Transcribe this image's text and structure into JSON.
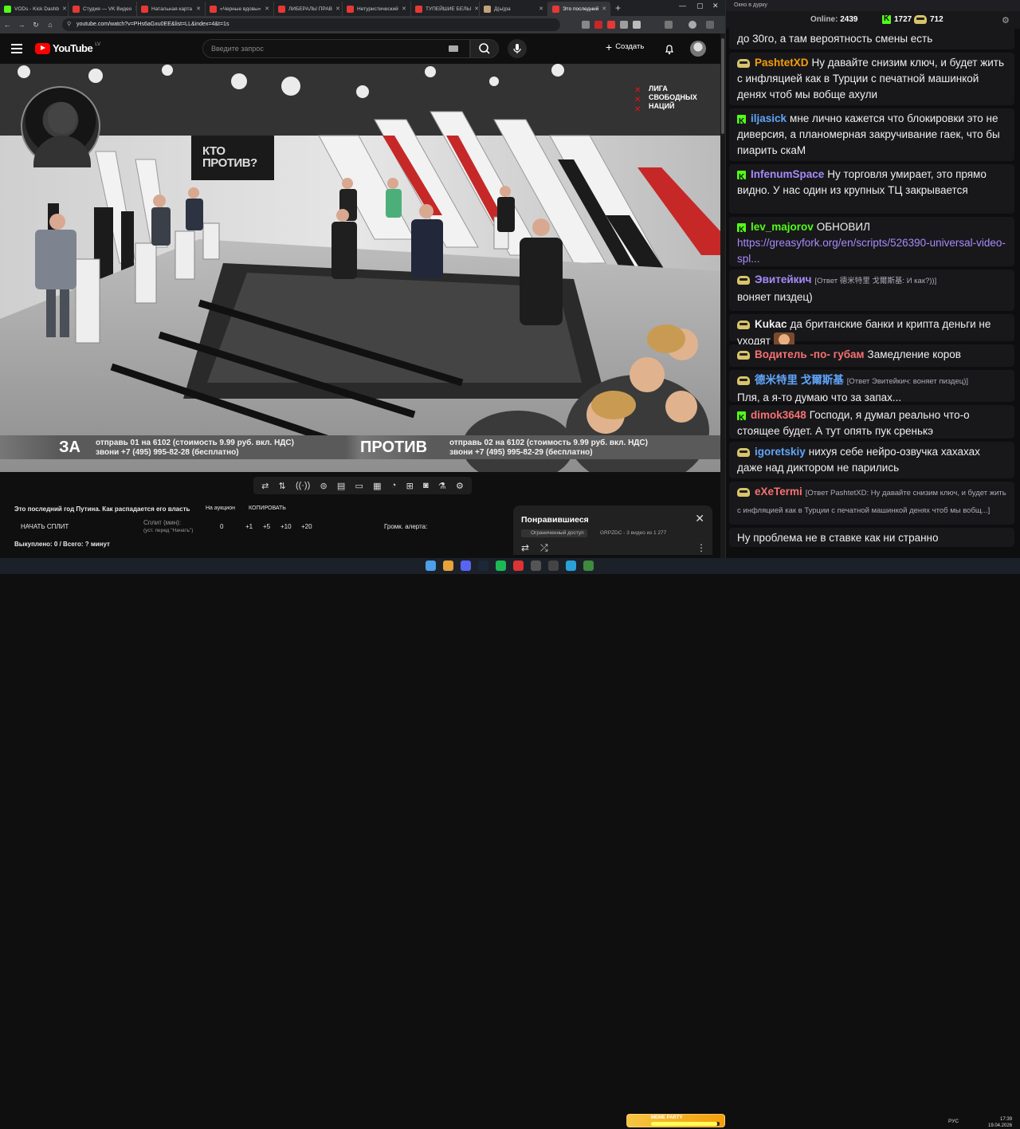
{
  "browser": {
    "tabs": [
      {
        "label": "VODs - Kick Dashb",
        "color": "#53fc18"
      },
      {
        "label": "Студия — VK Видео",
        "color": "#e53935"
      },
      {
        "label": "Натальная карта",
        "color": "#e53935"
      },
      {
        "label": "«Черные вдовы»",
        "color": "#e53935"
      },
      {
        "label": "ЛИБЕРАЛЫ ПРАВ",
        "color": "#e53935"
      },
      {
        "label": "Нетуристический",
        "color": "#e53935"
      },
      {
        "label": "ТУПЕЙШИЕ БЕЛЫ",
        "color": "#e53935"
      },
      {
        "label": "Д(ы)ра",
        "color": "#bfa37a"
      },
      {
        "label": "Это последний",
        "color": "#e53935"
      }
    ],
    "url": "youtube.com/watch?v=PHs6aGxu0EE&list=LL&index=4&t=1s"
  },
  "youtube": {
    "logo_text": "YouTube",
    "country": "LV",
    "search_placeholder": "Введите запрос",
    "create_label": "Создать"
  },
  "video": {
    "liga_text": "ЛИГА СВОБОДНЫХ НАЦИЙ",
    "kto_text": "КТО ПРОТИВ?",
    "za_label": "ЗА",
    "za_line1": "отправь 01 на 6102 (стоимость 9.99 руб. вкл. НДС)",
    "za_line2": "звони +7 (495) 995-82-28 (бесплатно)",
    "protiv_label": "ПРОТИВ",
    "protiv_line1": "отправь 02 на 6102 (стоимость 9.99 руб. вкл. НДС)",
    "protiv_line2": "звони +7 (495) 995-82-29 (бесплатно)"
  },
  "toolbar": {
    "icons": [
      "repeat-icon",
      "sort-icon",
      "audio-icon",
      "video-settings-icon",
      "film-icon",
      "picture-in-picture-icon",
      "subtitles-icon",
      "speed-icon",
      "add-box-icon",
      "camera-icon",
      "flask-icon",
      "gear-icon"
    ],
    "glyphs": [
      "⇄",
      "⇅",
      "((·))",
      "⊜",
      "▤",
      "▭",
      "▦",
      "◔",
      "⊞",
      "◙",
      "⚗",
      "⚙"
    ]
  },
  "split": {
    "title": "Это последний год Путина. Как распадается его власть",
    "auction": "На аукцион",
    "copy": "КОПИРОВАТЬ",
    "start": "НАЧАТЬ СПЛИТ",
    "split_min": "Сплит (мин):",
    "split_hint": "(уст. перед \"Начать\")",
    "value": "0",
    "add1": "+1",
    "add5": "+5",
    "add10": "+10",
    "add20": "+20",
    "alert_volume": "Громк. алерта:",
    "paid_line": "Выкуплено: 0 / Всего: ? минут"
  },
  "liked": {
    "title": "Понравившиеся",
    "access": "Ограниченный доступ",
    "meta": "GRPZDC - 3 видео из 1 277"
  },
  "chat": {
    "window_title": "Окно в дурку",
    "online_label": "Online:",
    "online_count": "2439",
    "kick_count": "1727",
    "emote_count": "712",
    "messages": [
      {
        "user": "",
        "reply": "",
        "text": "до 30го, а там вероятность смены есть",
        "color": "#efeff1",
        "icon": "none"
      },
      {
        "user": "PashtetXD",
        "reply": "",
        "text": "Ну давайте снизим ключ, и будет жить с инфляцией как в Турции с печатной машинкой денях чтоб мы вобще ахули",
        "color": "#f59e0b",
        "icon": "emote"
      },
      {
        "user": "iljasick",
        "reply": "",
        "text": "мне лично кажется что блокировки это не диверсия, а планомерная закручивание гаек, что бы пиарить скаМ",
        "color": "#60a5fa",
        "icon": "kick"
      },
      {
        "user": "InfenumSpace",
        "reply": "",
        "text": "Ну торговля умирает, это прямо видно. У нас один из крупных ТЦ закрывается",
        "color": "#a78bfa",
        "icon": "kick"
      },
      {
        "user": "lev_majorov",
        "reply": "",
        "text": "ОБНОВИЛ",
        "link": "https://greasyfork.org/en/scripts/526390-universal-video-spl...",
        "color": "#53fc18",
        "icon": "kick"
      },
      {
        "user": "Эвитейкич",
        "reply": "[Ответ 德米特里 戈爾斯基: И как?))]",
        "text": "воняет пиздец)",
        "color": "#a78bfa",
        "icon": "emote"
      },
      {
        "user": "Kukac",
        "reply": "",
        "text": "да британские банки и крипта деньги не уходят",
        "color": "#efeff1",
        "icon": "emote"
      },
      {
        "user": "Водитель -по- губам",
        "reply": "",
        "text": "Замедление коров",
        "color": "#f87171",
        "icon": "emote"
      },
      {
        "user": "德米特里 戈爾斯基",
        "reply": "[Ответ Эвитейкич: воняет пиздец)]",
        "text": "Пля, а я-то думаю что за запах...",
        "color": "#60a5fa",
        "icon": "emote"
      },
      {
        "user": "dimok3648",
        "reply": "",
        "text": "Господи, я думал реально что-о стоящее будет. А тут опять пук сренькэ",
        "color": "#f87171",
        "icon": "kick"
      },
      {
        "user": "igoretskiy",
        "reply": "",
        "text": "нихуя себе нейро-озвучка хахахах даже над диктором не парились",
        "color": "#60a5fa",
        "icon": "emote"
      },
      {
        "user": "eXeTermi",
        "reply": "[Ответ PashtetXD: Ну давайте снизим ключ, и будет жить с инфляцией как в Турции с печатной машинкой денях чтоб мы вобщ...]",
        "text": "",
        "color": "#f87171",
        "icon": "emote"
      },
      {
        "user": "",
        "reply": "",
        "text": "Ну проблема не в ставке как ни странно",
        "color": "#efeff1",
        "icon": "none"
      }
    ]
  },
  "taskbar": {
    "meme_label": "MEME PARTY",
    "meme_progress": "1454 / 1500",
    "meme_fill": 0.97,
    "lang": "РУС",
    "time": "17:39",
    "date": "19.04.2026"
  }
}
